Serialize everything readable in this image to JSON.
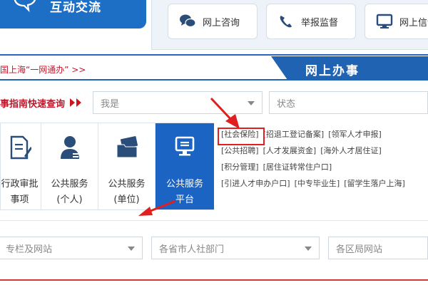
{
  "header": {
    "hudong_title": "互动交流",
    "buttons": [
      {
        "label": "网上咨询",
        "icon": "chat-icon"
      },
      {
        "label": "举报监督",
        "icon": "phone-icon"
      },
      {
        "label": "网上信访",
        "icon": "monitor-icon"
      }
    ]
  },
  "breadcrumb": "国上海“一网通办” >>",
  "section_tab": "网上办事",
  "quick": {
    "label": "事指南快速查询",
    "select1_placeholder": "我是",
    "select2_placeholder": "状态"
  },
  "tiles": [
    {
      "line1": "行政审批",
      "line2": "事项",
      "icon": "document-edit-icon"
    },
    {
      "line1": "公共服务",
      "line2": "(个人)",
      "icon": "person-icon"
    },
    {
      "line1": "公共服务",
      "line2": "(单位)",
      "icon": "folder-card-icon"
    },
    {
      "line1": "公共服务",
      "line2": "平台",
      "icon": "monitor-icon"
    }
  ],
  "links": [
    [
      "[社会保险]",
      "[招退工登记备案]",
      "[领军人才申报]"
    ],
    [
      "[公共招聘]",
      "[人才发展资金]",
      "[海外人才居住证]"
    ],
    [
      "[积分管理]",
      "[居住证转常住户口]"
    ],
    [
      "[引进人才申办户口]",
      "[中专毕业生]",
      "[留学生落户上海]"
    ]
  ],
  "bottom_selects": [
    "专栏及网站",
    "各省市人社部门",
    "各区局网站"
  ],
  "colors": {
    "brand_blue": "#1b64c3",
    "accent_red": "#c0162c",
    "highlight_red": "#e02020"
  }
}
